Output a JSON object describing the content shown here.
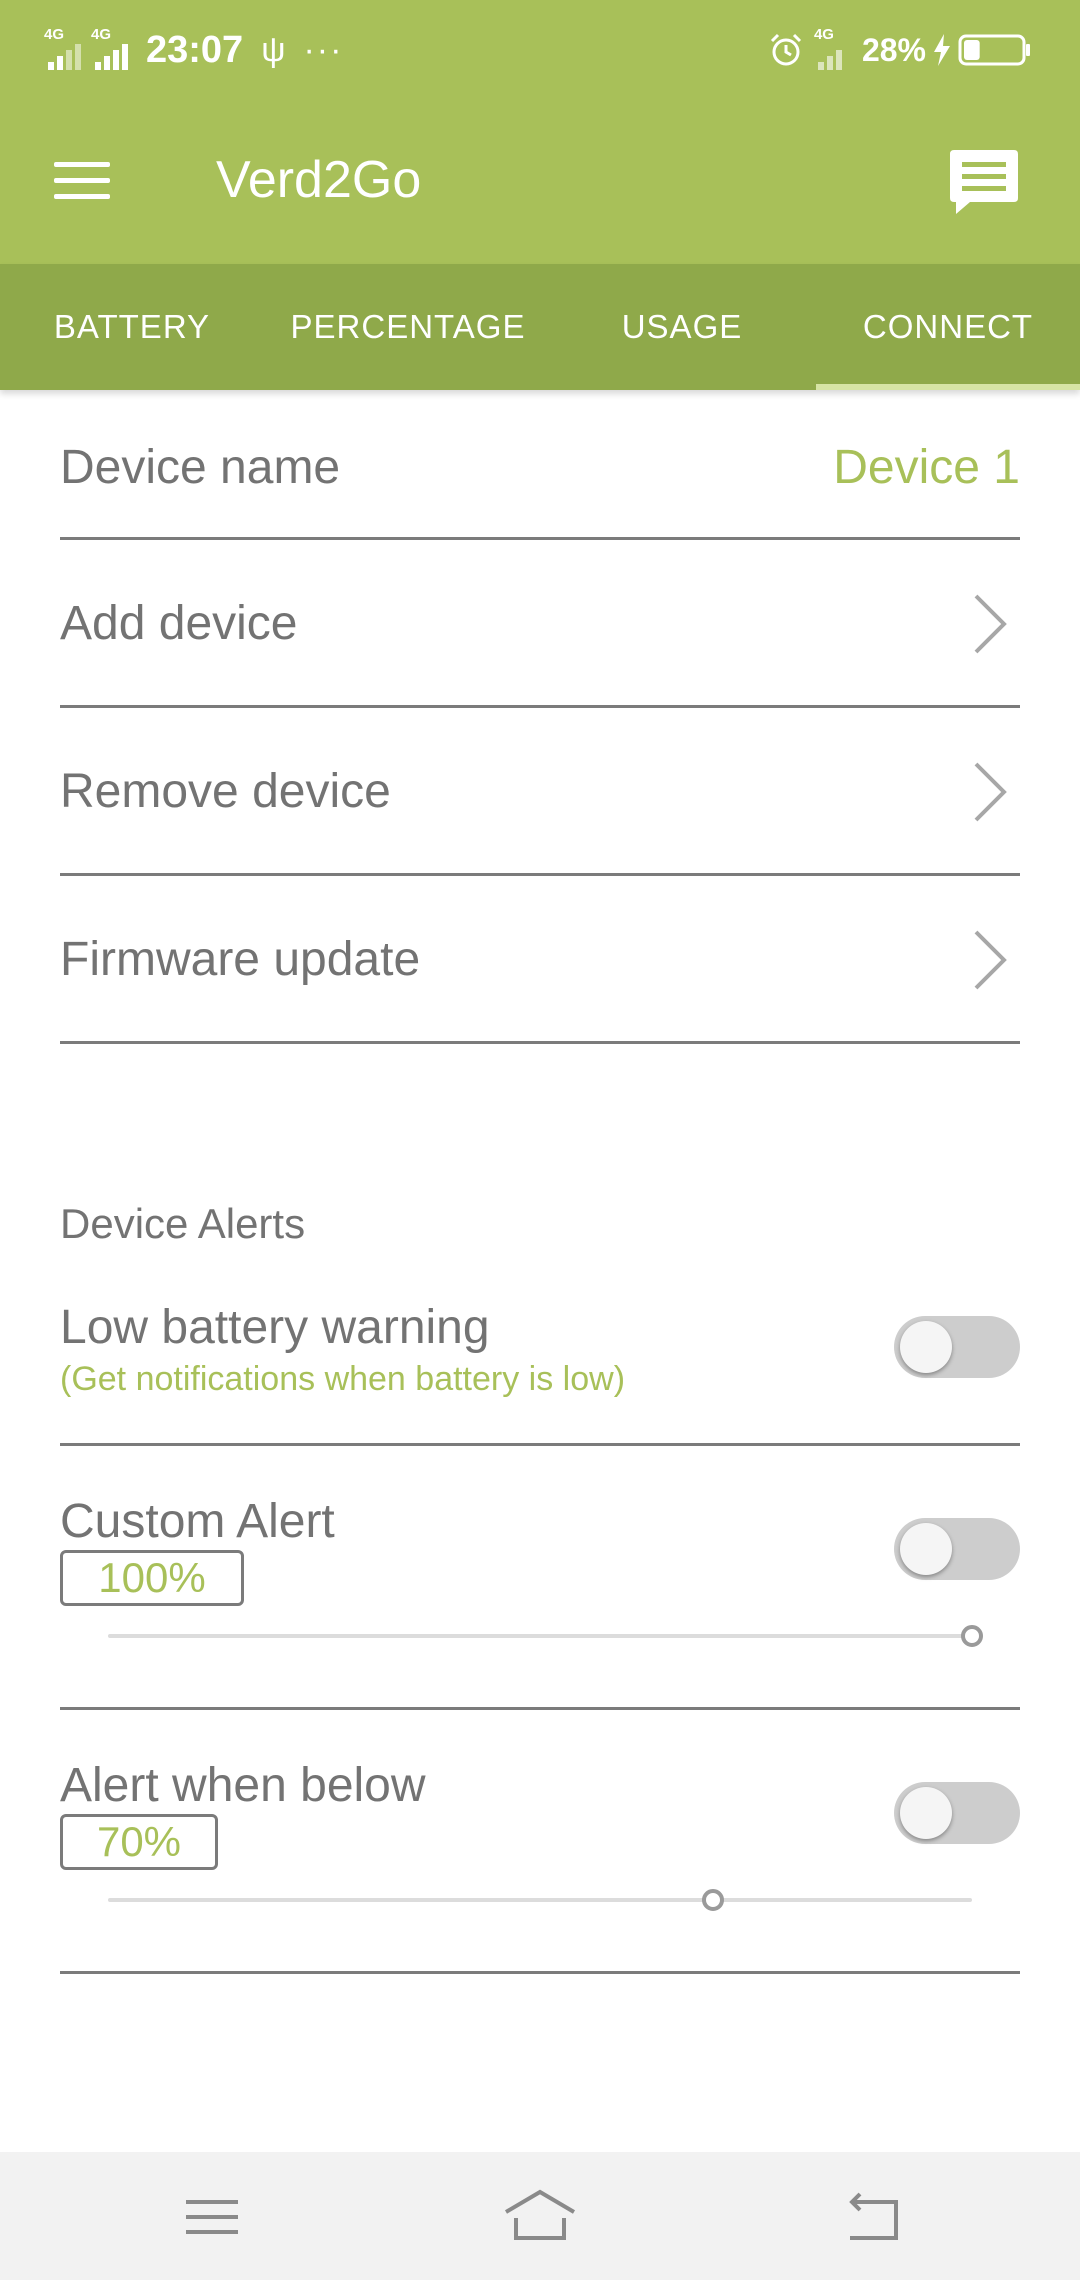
{
  "status_bar": {
    "signal1_tag": "4G",
    "signal2_tag": "4G",
    "time": "23:07",
    "usb_icon": "usb-icon",
    "more_icon": "···",
    "alarm_icon": "alarm-icon",
    "signal3_tag": "4G",
    "battery_percent": "28%",
    "battery_level": 0.28,
    "charging_icon": "lightning-icon"
  },
  "app_bar": {
    "title": "Verd2Go",
    "menu_icon": "hamburger-menu-icon",
    "action_icon": "chat-message-icon"
  },
  "tabs": [
    {
      "label": "BATTERY",
      "active": false
    },
    {
      "label": "PERCENTAGE",
      "active": false
    },
    {
      "label": "USAGE",
      "active": false
    },
    {
      "label": "CONNECT",
      "active": true
    }
  ],
  "device_settings": {
    "device_name_label": "Device name",
    "device_name_value": "Device 1",
    "add_device_label": "Add device",
    "remove_device_label": "Remove device",
    "firmware_update_label": "Firmware update"
  },
  "alerts": {
    "section_title": "Device Alerts",
    "low_battery": {
      "title": "Low battery warning",
      "subtitle": "(Get notifications when battery is low)",
      "enabled": false
    },
    "custom_alert": {
      "title": "Custom Alert",
      "value_label": "100%",
      "value": 100,
      "enabled": false
    },
    "alert_below": {
      "title": "Alert when below",
      "value_label": "70%",
      "value": 70,
      "enabled": false
    }
  },
  "nav_bar": {
    "menu_icon": "recent-apps-icon",
    "home_icon": "home-icon",
    "back_icon": "back-icon"
  },
  "colors": {
    "primary": "#a8c059",
    "tab_bar": "#8fa94a",
    "accent_text": "#a8c059",
    "divider": "#7b7b7b"
  }
}
